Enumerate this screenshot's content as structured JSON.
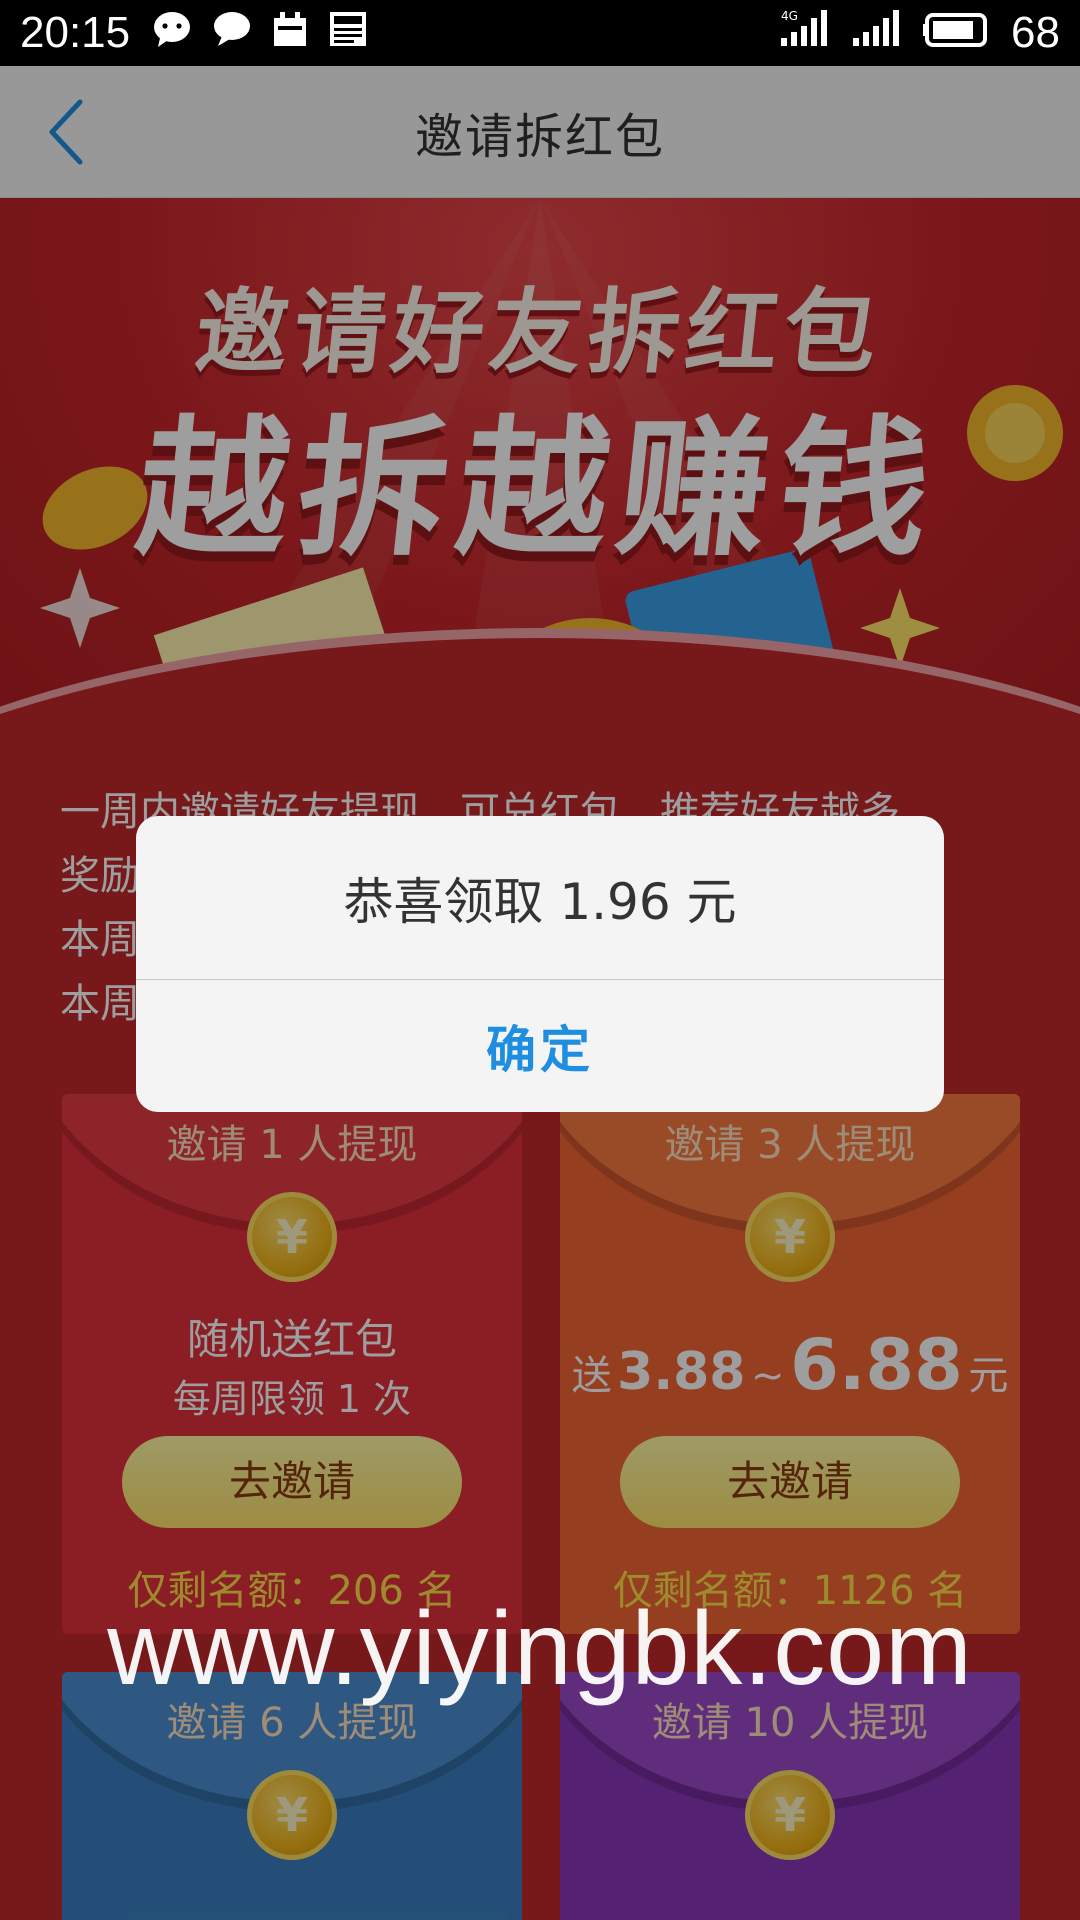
{
  "status_bar": {
    "time": "20:15",
    "battery": "68",
    "icons": [
      "chat-bubble-icon",
      "message-icon",
      "calendar-icon",
      "news-icon",
      "signal-4g-icon",
      "signal-icon",
      "battery-icon"
    ]
  },
  "navbar": {
    "back_icon": "chevron-left-icon",
    "title": "邀请拆红包"
  },
  "hero": {
    "line1": "邀请好友拆红包",
    "line2": "越拆越赚钱"
  },
  "description": {
    "line1": "一周内邀请好友提现，可兑红包，推荐好友越多，",
    "line2": "奖励",
    "line3": "本周",
    "line4": "本周"
  },
  "cards": [
    {
      "title": "邀请 1 人提现",
      "line1": "随机送红包",
      "line2": "每周限领 1 次",
      "button": "去邀请",
      "quota": "仅剩名额：206 名"
    },
    {
      "title": "邀请 3 人提现",
      "range_prefix": "送",
      "range_min": "3.88",
      "range_sep": "~",
      "range_max": "6.88",
      "range_unit": "元",
      "button": "去邀请",
      "quota": "仅剩名额：1126 名"
    },
    {
      "title": "邀请 6 人提现"
    },
    {
      "title": "邀请 10 人提现"
    }
  ],
  "dialog": {
    "message": "恭喜领取 1.96 元",
    "confirm": "确定"
  },
  "watermark": "www.yiyingbk.com",
  "colors": {
    "dialog_button": "#1f8ee0",
    "page_red": "#c0282c",
    "quota_yellow": "#ffe04a"
  }
}
